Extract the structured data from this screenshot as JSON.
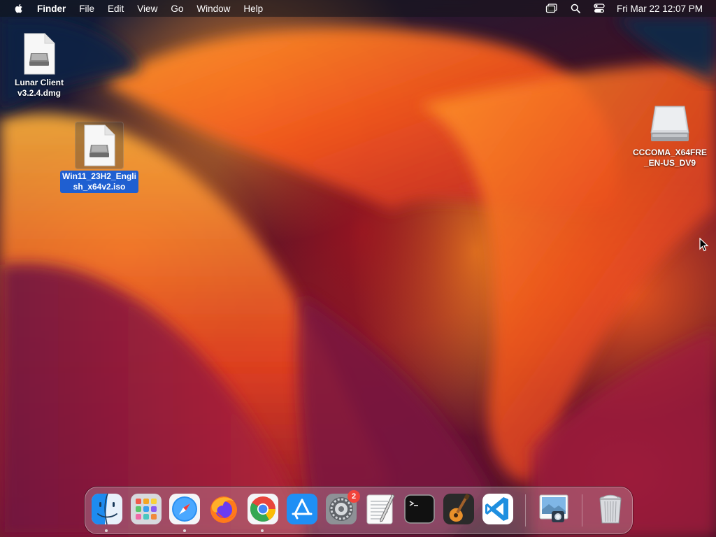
{
  "menubar": {
    "app_name": "Finder",
    "menus": [
      "File",
      "Edit",
      "View",
      "Go",
      "Window",
      "Help"
    ],
    "status_icons": [
      "screen-mirroring-icon",
      "search-icon",
      "control-center-icon"
    ],
    "clock": "Fri Mar 22  12:07 PM"
  },
  "desktop": {
    "icons": [
      {
        "label": "Lunar Client v3.2.4.dmg",
        "line1": "Lunar Client",
        "line2": "v3.2.4.dmg",
        "kind": "disk-image-file-icon",
        "selected": false
      },
      {
        "label": "Win11_23H2_English_x64v2.iso",
        "line1": "Win11_23H2_Engli",
        "line2": "sh_x64v2.iso",
        "kind": "disk-image-file-icon",
        "selected": true
      },
      {
        "label": "CCCOMA_X64FRE_EN-US_DV9",
        "line1": "CCCOMA_X64FRE",
        "line2": "_EN-US_DV9",
        "kind": "mounted-volume-icon",
        "selected": false
      }
    ]
  },
  "dock": {
    "apps": [
      {
        "name": "Finder",
        "icon": "finder-icon",
        "running": true
      },
      {
        "name": "Launchpad",
        "icon": "launchpad-icon",
        "running": false
      },
      {
        "name": "Safari",
        "icon": "safari-icon",
        "running": true
      },
      {
        "name": "Firefox",
        "icon": "firefox-icon",
        "running": false
      },
      {
        "name": "Google Chrome",
        "icon": "chrome-icon",
        "running": true
      },
      {
        "name": "App Store",
        "icon": "app-store-icon",
        "running": false
      },
      {
        "name": "System Settings",
        "icon": "system-settings-icon",
        "running": false,
        "badge": "2"
      },
      {
        "name": "TextEdit",
        "icon": "textedit-icon",
        "running": false
      },
      {
        "name": "Terminal",
        "icon": "terminal-icon",
        "running": false
      },
      {
        "name": "GarageBand",
        "icon": "garageband-icon",
        "running": false
      },
      {
        "name": "Visual Studio Code",
        "icon": "vscode-icon",
        "running": false
      },
      {
        "name": "Preview",
        "icon": "preview-icon",
        "running": false
      },
      {
        "name": "Trash",
        "icon": "trash-icon",
        "running": false
      }
    ]
  },
  "colors": {
    "menubar_bg": "#1a1a1f",
    "selection_blue": "#1f5fd1",
    "badge_red": "#f2433b"
  }
}
